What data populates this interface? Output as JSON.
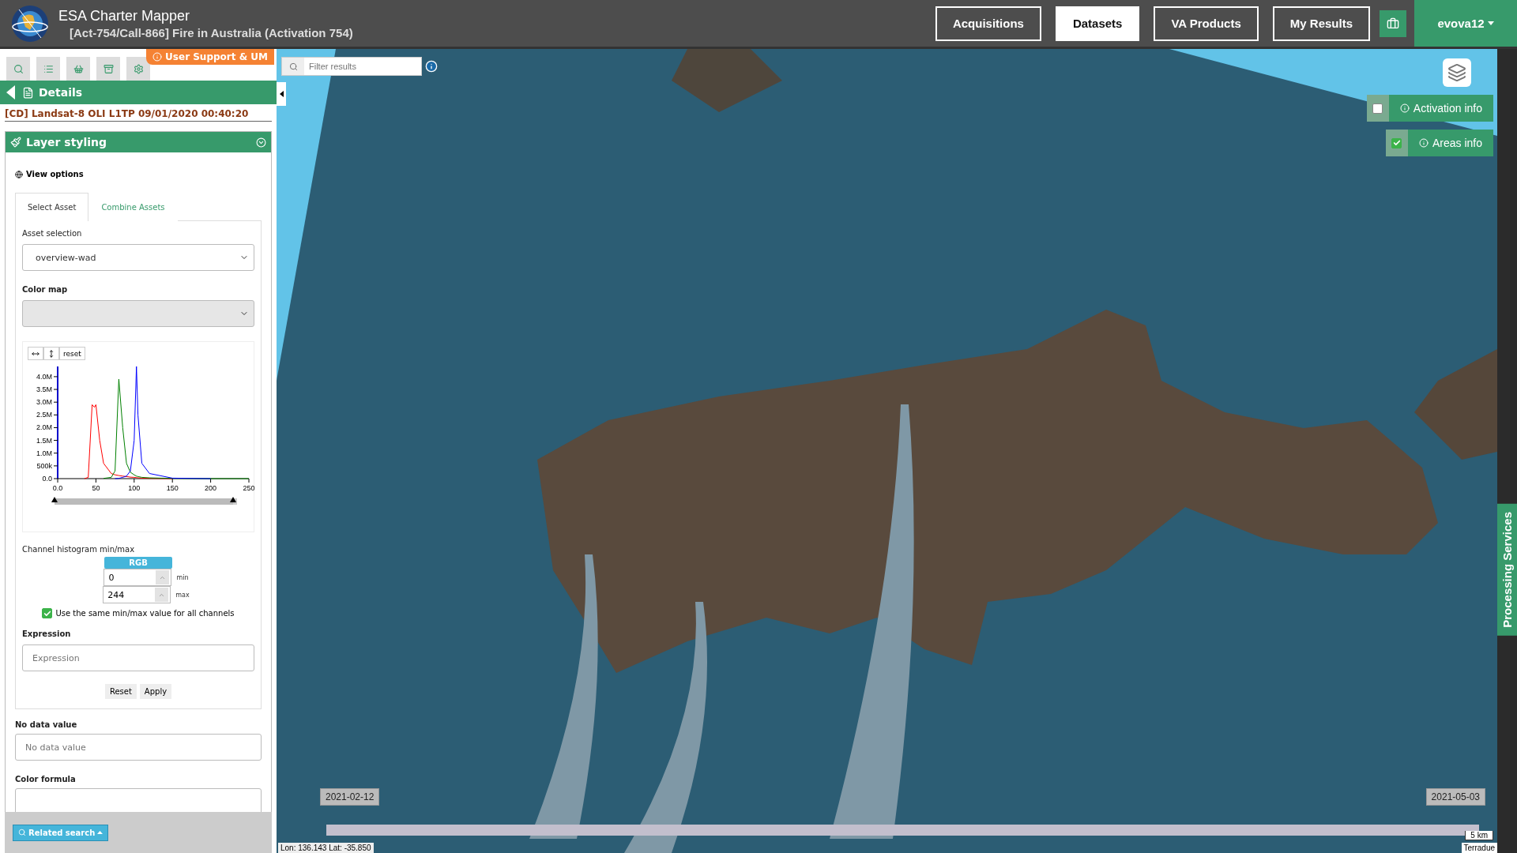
{
  "header": {
    "app_title": "ESA Charter Mapper",
    "activation_title": "[Act-754/Call-866] Fire in Australia (Activation 754)",
    "nav": [
      {
        "label": "Acquisitions",
        "selected": false
      },
      {
        "label": "Datasets",
        "selected": true
      },
      {
        "label": "VA Products",
        "selected": false
      },
      {
        "label": "My Results",
        "selected": false
      }
    ],
    "user": "evova12"
  },
  "sidebar": {
    "support_link": "User Support & UM",
    "details_title": "Details",
    "product_title": "[CD] Landsat-8 OLI L1TP 09/01/2020 00:40:20",
    "panel_title": "Layer styling",
    "view_options": "View options",
    "tabs": [
      {
        "label": "Select Asset",
        "selected": true
      },
      {
        "label": "Combine Assets",
        "selected": false
      }
    ],
    "asset_label": "Asset selection",
    "asset_value": "overview-wad",
    "color_map_label": "Color map",
    "histogram": {
      "reset": "reset",
      "range": {
        "level": 0.98
      },
      "chart_data": {
        "type": "line",
        "x": [
          35,
          40,
          45,
          48,
          50,
          55,
          60,
          70,
          75,
          80,
          85,
          90,
          95,
          100,
          103,
          105,
          110,
          120,
          150,
          200,
          250
        ],
        "xlim": [
          0,
          250
        ],
        "ylim": [
          0,
          4400000
        ],
        "xticks": [
          {
            "value": 0,
            "label": "0.0"
          },
          50,
          100,
          150,
          200,
          250
        ],
        "yticks": [
          {
            "value": 0,
            "label": "0.0"
          },
          {
            "value": 500000,
            "label": "500k"
          },
          {
            "value": 1000000,
            "label": "1.0M"
          },
          {
            "value": 1500000,
            "label": "1.5M"
          },
          {
            "value": 2000000,
            "label": "2.0M"
          },
          {
            "value": 2500000,
            "label": "2.5M"
          },
          {
            "value": 3000000,
            "label": "3.0M"
          },
          {
            "value": 3500000,
            "label": "3.5M"
          },
          {
            "value": 4000000,
            "label": "4.0M"
          }
        ],
        "series": [
          {
            "color": "#ff0000",
            "values": [
              0,
              50000,
              2900000,
              2800000,
              2900000,
              1500000,
              600000,
              200000,
              150000,
              120000,
              100000,
              80000,
              60000,
              50000,
              40000,
              30000,
              20000,
              10000,
              0,
              null,
              null
            ]
          },
          {
            "color": "#008000",
            "values": [
              null,
              null,
              null,
              null,
              null,
              null,
              10000,
              50000,
              300000,
              3900000,
              2000000,
              600000,
              250000,
              150000,
              100000,
              80000,
              50000,
              30000,
              10000,
              0,
              0
            ]
          },
          {
            "color": "#0000ff",
            "values": [
              null,
              null,
              null,
              null,
              null,
              null,
              null,
              null,
              0,
              10000,
              50000,
              100000,
              300000,
              1500000,
              4400000,
              2500000,
              600000,
              200000,
              20000,
              0,
              null
            ]
          }
        ]
      }
    },
    "channel_label": "Channel histogram min/max",
    "channel_tab": "RGB",
    "min": {
      "value": "0",
      "label": "min"
    },
    "max": {
      "value": "244",
      "label": "max"
    },
    "same_minmax": {
      "label": "Use the same min/max value for all channels",
      "checked": true
    },
    "expression_label": "Expression",
    "expression_placeholder": "Expression",
    "buttons": [
      "Reset",
      "Apply"
    ],
    "nodata_label": "No data value",
    "nodata_placeholder": "No data value",
    "color_formula_label": "Color formula",
    "related_search": "Related search"
  },
  "map": {
    "filter_placeholder": "Filter results",
    "overlays": [
      {
        "label": "Activation info",
        "checked": false
      },
      {
        "label": "Areas info",
        "checked": true
      }
    ],
    "processing_tab": "Processing Services",
    "timeline": {
      "start": "2021-02-12",
      "end": "2021-05-03",
      "level": 1
    },
    "coordinates": "Lon: 136.143 Lat: -35.850",
    "scale": "5 km",
    "attribution": "Terradue"
  }
}
